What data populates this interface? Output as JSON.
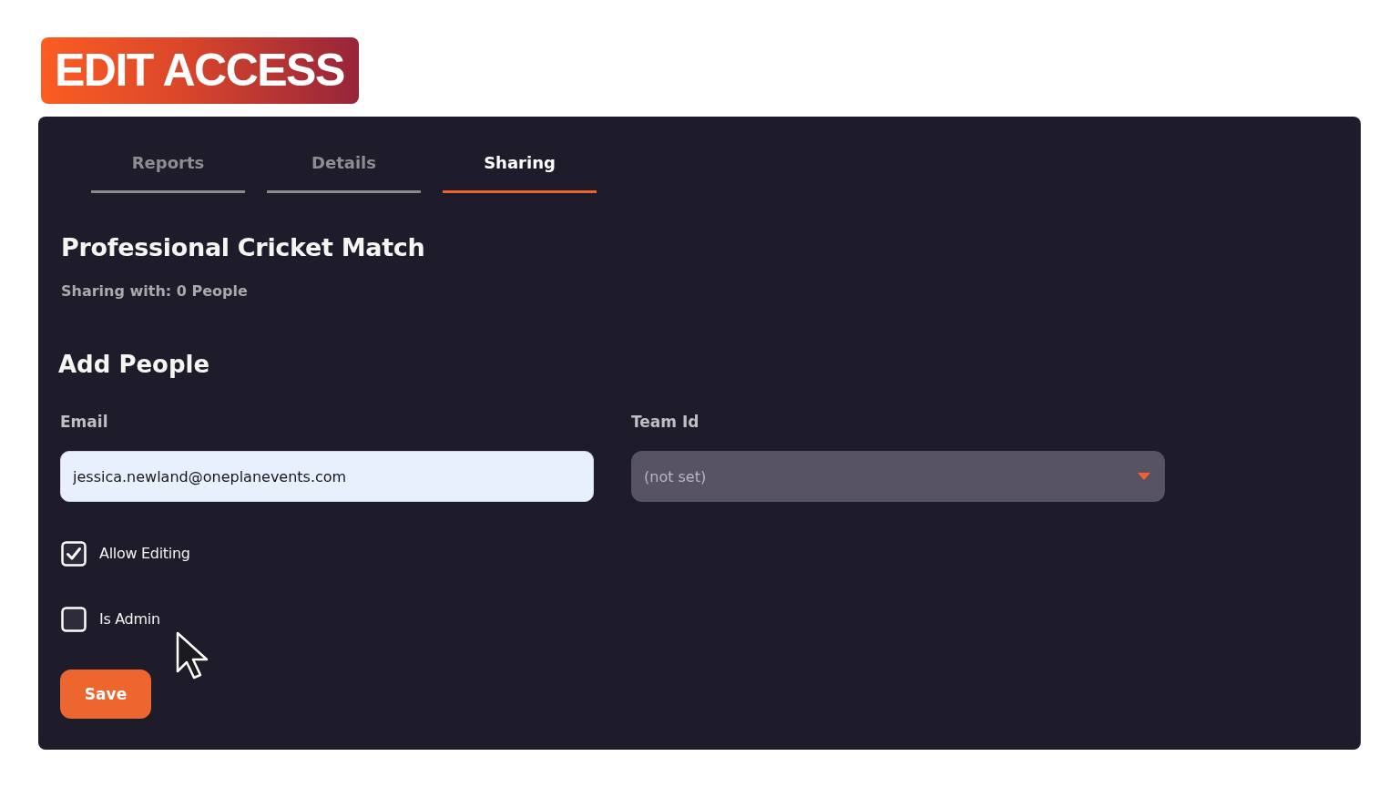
{
  "header": {
    "title": "EDIT ACCESS"
  },
  "tabs": [
    {
      "label": "Reports",
      "selected": false
    },
    {
      "label": "Details",
      "selected": false
    },
    {
      "label": "Sharing",
      "selected": true
    }
  ],
  "event": {
    "title": "Professional Cricket Match",
    "sharing_summary": "Sharing with: 0 People"
  },
  "add_people": {
    "heading": "Add People",
    "fields": [
      {
        "kind": "text",
        "label": "Email",
        "value": "jessica.newland@oneplanevents.com"
      },
      {
        "kind": "select",
        "label": "Team Id",
        "value": "(not set)"
      }
    ],
    "options": [
      {
        "label": "Allow Editing",
        "checked": true
      },
      {
        "label": "Is Admin",
        "checked": false
      }
    ],
    "save_button": "Save"
  }
}
